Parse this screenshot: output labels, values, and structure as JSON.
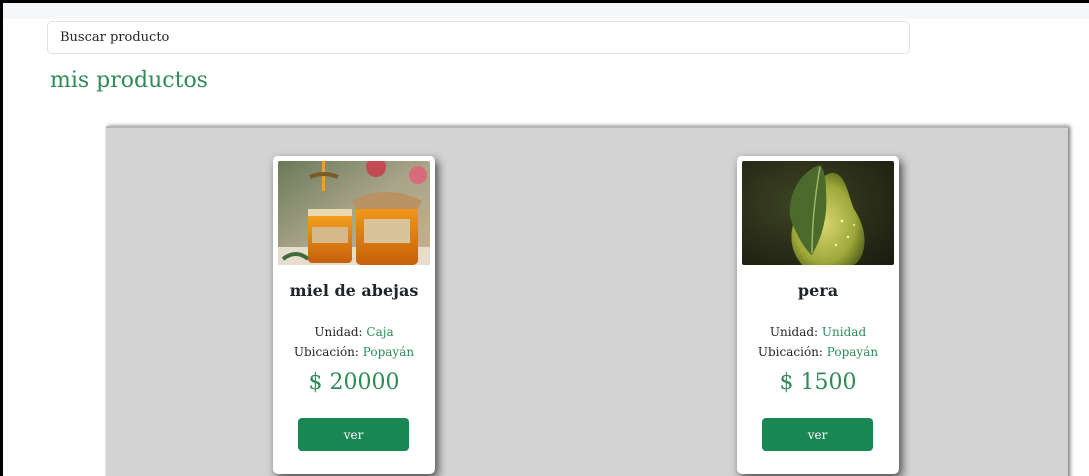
{
  "search": {
    "placeholder": "Buscar producto"
  },
  "page": {
    "title": "mis productos"
  },
  "labels": {
    "unit": "Unidad: ",
    "location": "Ubicación: "
  },
  "colors": {
    "accent": "#2e8b57",
    "button": "#198754",
    "panel": "#d3d3d3"
  },
  "products": [
    {
      "name": "miel de abejas",
      "unit": "Caja",
      "location": "Popayán",
      "price": "$ 20000",
      "button_label": "ver",
      "image": "honey-jars-photo"
    },
    {
      "name": "pera",
      "unit": "Unidad",
      "location": "Popayán",
      "price": "$ 1500",
      "button_label": "ver",
      "image": "pear-photo"
    }
  ]
}
